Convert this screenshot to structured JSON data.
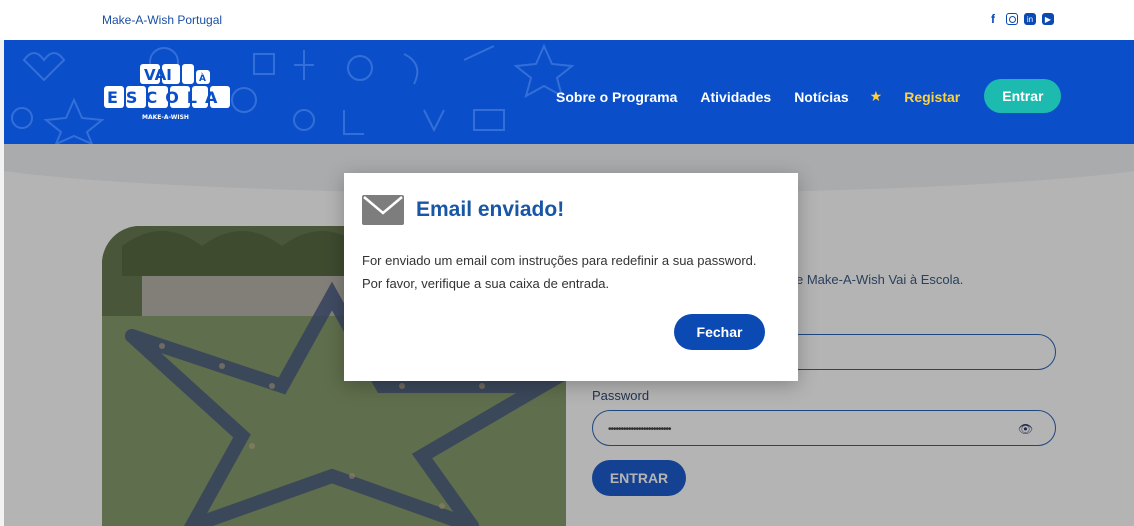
{
  "topbar": {
    "brand": "Make-A-Wish Portugal",
    "social": [
      {
        "icon": "facebook-icon",
        "glyph": "f"
      },
      {
        "icon": "instagram-icon"
      },
      {
        "icon": "linkedin-icon",
        "glyph": "in"
      },
      {
        "icon": "youtube-icon",
        "glyph": "▶"
      }
    ]
  },
  "header": {
    "logo": {
      "line1": "VAI",
      "line1b": "À",
      "line2": "ESCOLA",
      "tagline": "MAKE-A-WISH"
    },
    "nav": {
      "about": "Sobre o Programa",
      "activities": "Atividades",
      "news": "Notícias",
      "register": "Registar",
      "enter": "Entrar"
    }
  },
  "page": {
    "intro_visible": "e Make-A-Wish Vai à Escola.",
    "password_label": "Password",
    "password_value": "•••••••••••••••••••••••••",
    "login_button": "ENTRAR"
  },
  "modal": {
    "title": "Email enviado!",
    "message": "For enviado um email com instruções para redefinir a sua password. Por favor, verifique a sua caixa de entrada.",
    "close_button": "Fechar"
  },
  "colors": {
    "header_blue": "#0a4fc9",
    "accent_teal": "#1dbab0",
    "accent_yellow": "#ffd23a",
    "modal_title": "#1857a6"
  }
}
